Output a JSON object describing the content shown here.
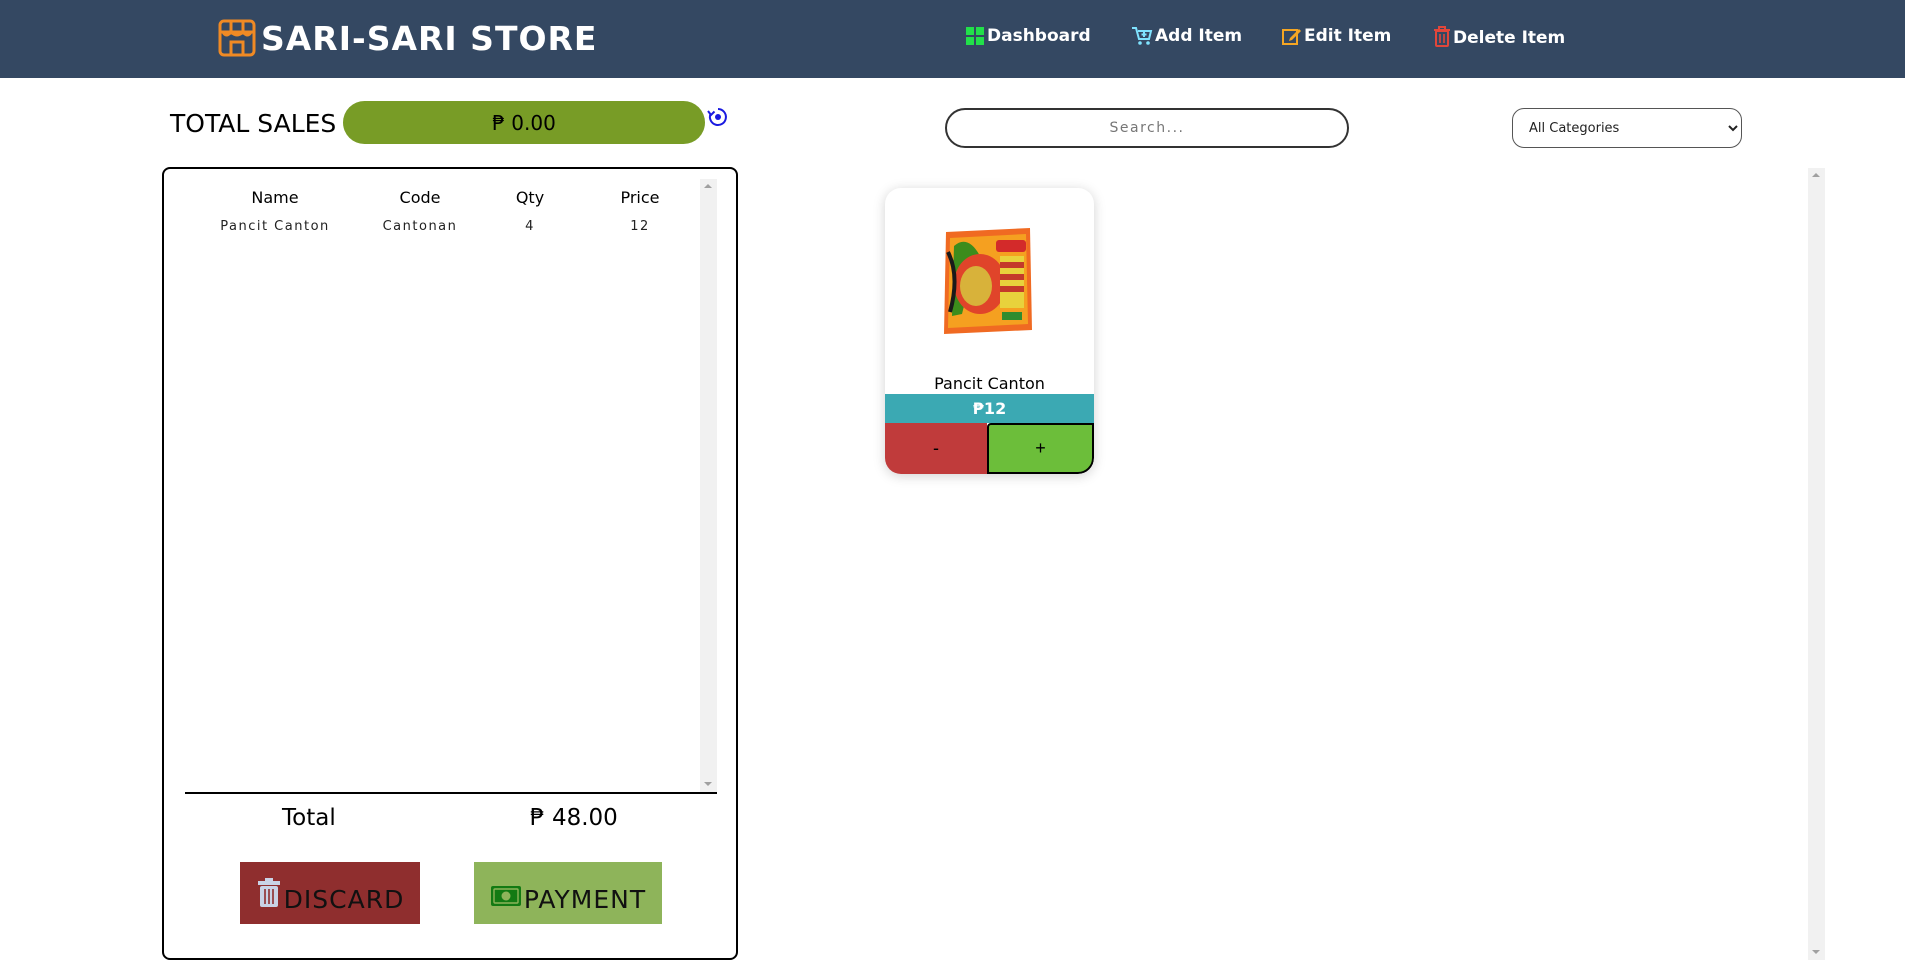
{
  "header": {
    "brand_title": "SARI-SARI STORE",
    "nav": [
      {
        "label": "Dashboard",
        "icon": "dashboard-grid-icon",
        "icon_color": "#22e04a"
      },
      {
        "label": "Add Item",
        "icon": "cart-add-icon",
        "icon_color": "#7fe3ff"
      },
      {
        "label": "Edit Item",
        "icon": "edit-icon",
        "icon_color": "#f5a623"
      },
      {
        "label": "Delete Item",
        "icon": "trash-icon",
        "icon_color": "#e2463a"
      }
    ]
  },
  "sales": {
    "label": "TOTAL SALES",
    "value": "₱ 0.00"
  },
  "cart": {
    "columns": [
      "Name",
      "Code",
      "Qty",
      "Price"
    ],
    "rows": [
      {
        "name": "Pancit Canton",
        "code": "Cantonan",
        "qty": "4",
        "price": "12"
      }
    ],
    "total_label": "Total",
    "total_value": "₱ 48.00",
    "discard_label": "DISCARD",
    "payment_label": "PAYMENT"
  },
  "search": {
    "placeholder": "Search...",
    "value": ""
  },
  "category_filter": {
    "selected": "All Categories"
  },
  "products": [
    {
      "name": "Pancit Canton",
      "price": "₱12",
      "minus_label": "-",
      "plus_label": "+"
    }
  ],
  "colors": {
    "header_bg": "#344862",
    "sales_pill": "#789c26",
    "discard": "#8f2e2e",
    "payment": "#8eb45a",
    "price_bar": "#3ba9b3",
    "minus": "#c03b3b",
    "plus": "#6cbe3a"
  }
}
